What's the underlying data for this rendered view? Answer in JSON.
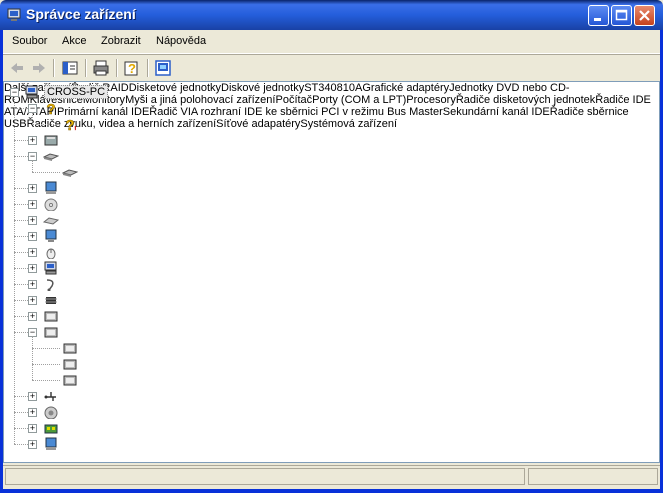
{
  "window": {
    "title": "Správce zařízení"
  },
  "menu": [
    "Soubor",
    "Akce",
    "Zobrazit",
    "Nápověda"
  ],
  "toolbar": {
    "icons": [
      "back-arrow-icon",
      "forward-arrow-icon",
      "show-hide-console-tree-icon",
      "print-icon",
      "help-icon",
      "properties-icon"
    ]
  },
  "tree": {
    "root": "CROSS-PC",
    "items": [
      {
        "label": "Další zařízení",
        "icon": "unknown-device-icon",
        "expanded": true,
        "children": [
          "Řadič RAID"
        ]
      },
      {
        "label": "Disketové jednotky",
        "icon": "floppy-drive-icon",
        "expanded": false
      },
      {
        "label": "Diskové jednotky",
        "icon": "disk-drive-icon",
        "expanded": true,
        "children": [
          "ST340810A"
        ]
      },
      {
        "label": "Grafické adaptéry",
        "icon": "display-adapter-icon",
        "expanded": false
      },
      {
        "label": "Jednotky DVD nebo CD-ROM",
        "icon": "cdrom-icon",
        "expanded": false
      },
      {
        "label": "Klávesnice",
        "icon": "keyboard-icon",
        "expanded": false
      },
      {
        "label": "Monitory",
        "icon": "monitor-icon",
        "expanded": false
      },
      {
        "label": "Myši a jiná polohovací zařízení",
        "icon": "mouse-icon",
        "expanded": false
      },
      {
        "label": "Počítač",
        "icon": "computer-icon",
        "expanded": false
      },
      {
        "label": "Porty (COM a LPT)",
        "icon": "port-icon",
        "expanded": false
      },
      {
        "label": "Procesory",
        "icon": "processor-icon",
        "expanded": false
      },
      {
        "label": "Řadiče disketových jednotek",
        "icon": "floppy-controller-icon",
        "expanded": false
      },
      {
        "label": "Řadiče IDE ATA/ATAPI",
        "icon": "ide-controller-icon",
        "expanded": true,
        "children": [
          "Primární kanál IDE",
          "Řadič VIA rozhraní IDE ke sběrnici PCI v režimu Bus Master",
          "Sekundární kanál IDE"
        ]
      },
      {
        "label": "Řadiče sběrnice USB",
        "icon": "usb-icon",
        "expanded": false
      },
      {
        "label": "Řadiče zvuku, videa a herních zařízení",
        "icon": "sound-icon",
        "expanded": false
      },
      {
        "label": "Síťové adapatéry",
        "icon": "network-adapter-icon",
        "expanded": false
      },
      {
        "label": "Systémová zařízení",
        "icon": "system-device-icon",
        "expanded": false
      }
    ]
  },
  "colors": {
    "titlebar": "#245edb",
    "window_bg": "#ece9d8",
    "close_button": "#c6421c"
  }
}
